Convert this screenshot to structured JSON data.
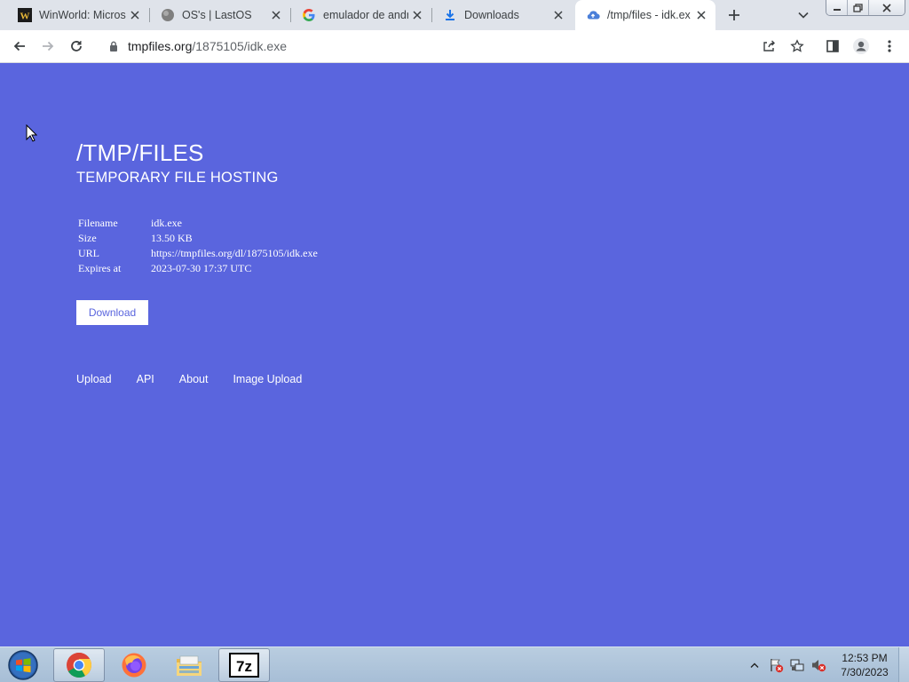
{
  "browser": {
    "tabs": [
      {
        "title": "WinWorld: Micros",
        "favicon": "winworld-icon",
        "active": false
      },
      {
        "title": "OS's | LastOS",
        "favicon": "lastos-icon",
        "active": false
      },
      {
        "title": "emulador de andr",
        "favicon": "google-icon",
        "active": false
      },
      {
        "title": "Downloads",
        "favicon": "download-icon",
        "active": false
      },
      {
        "title": "/tmp/files - idk.ex",
        "favicon": "cloud-upload-icon",
        "active": true
      }
    ],
    "address": {
      "host": "tmpfiles.org",
      "path": "/1875105/idk.exe"
    }
  },
  "page": {
    "title": "/TMP/FILES",
    "subtitle": "TEMPORARY FILE HOSTING",
    "file_info": [
      {
        "label": "Filename",
        "value": "idk.exe"
      },
      {
        "label": "Size",
        "value": "13.50 KB"
      },
      {
        "label": "URL",
        "value": "https://tmpfiles.org/dl/1875105/idk.exe"
      },
      {
        "label": "Expires at",
        "value": "2023-07-30 17:37 UTC"
      }
    ],
    "download_label": "Download",
    "footer_links": [
      "Upload",
      "API",
      "About",
      "Image Upload"
    ],
    "background_color": "#5a65de"
  },
  "taskbar": {
    "apps": [
      {
        "name": "chrome-icon",
        "open": true
      },
      {
        "name": "firefox-icon",
        "open": false
      },
      {
        "name": "file-explorer-icon",
        "open": false
      },
      {
        "name": "7zip-icon",
        "label": "7z",
        "open": true
      }
    ],
    "tray_icons": [
      "show-hidden-icons",
      "action-center-icon",
      "network-icon",
      "volume-muted-icon"
    ],
    "clock_time": "12:53 PM",
    "clock_date": "7/30/2023"
  }
}
